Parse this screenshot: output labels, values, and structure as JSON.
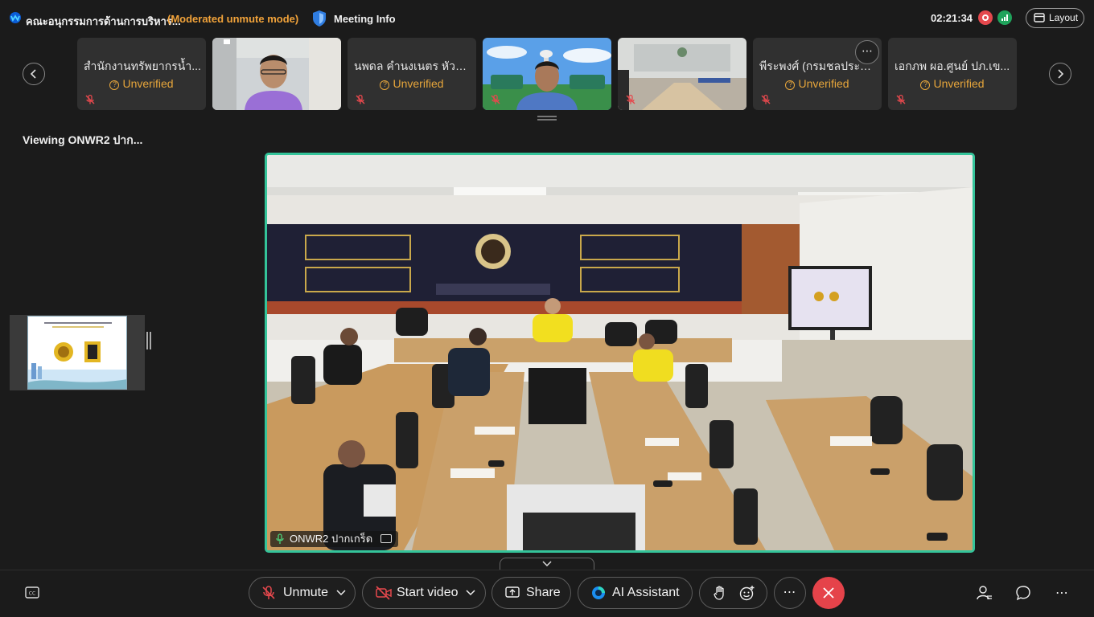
{
  "topbar": {
    "meeting_title": "คณะอนุกรรมการด้านการบริหาร...",
    "mode": "(Moderated unmute mode)",
    "meeting_info": "Meeting Info",
    "clock": "02:21:34",
    "layout": "Layout",
    "accent_color": "#f2a33a"
  },
  "participants": [
    {
      "name": "สำนักงานทรัพยากรน้ำ...",
      "status": "Unverified"
    },
    {
      "name": "",
      "status": ""
    },
    {
      "name": "นพดล คำนงเนตร หัวห...",
      "status": "Unverified"
    },
    {
      "name": "",
      "status": ""
    },
    {
      "name": "",
      "status": ""
    },
    {
      "name": "พีระพงศ์ (กรมชลประทาน",
      "status": "Unverified"
    },
    {
      "name": "เอกภพ ผอ.ศูนย์ ปภ.เข...",
      "status": "Unverified"
    }
  ],
  "viewing_label": "Viewing ONWR2 ปาก...",
  "main_video": {
    "name_tag": "ONWR2 ปากเกร็ด",
    "border_color": "#34c49a"
  },
  "controls": {
    "unmute": "Unmute",
    "start_video": "Start video",
    "share": "Share",
    "ai_assistant": "AI Assistant",
    "leave_color": "#e5434a"
  }
}
